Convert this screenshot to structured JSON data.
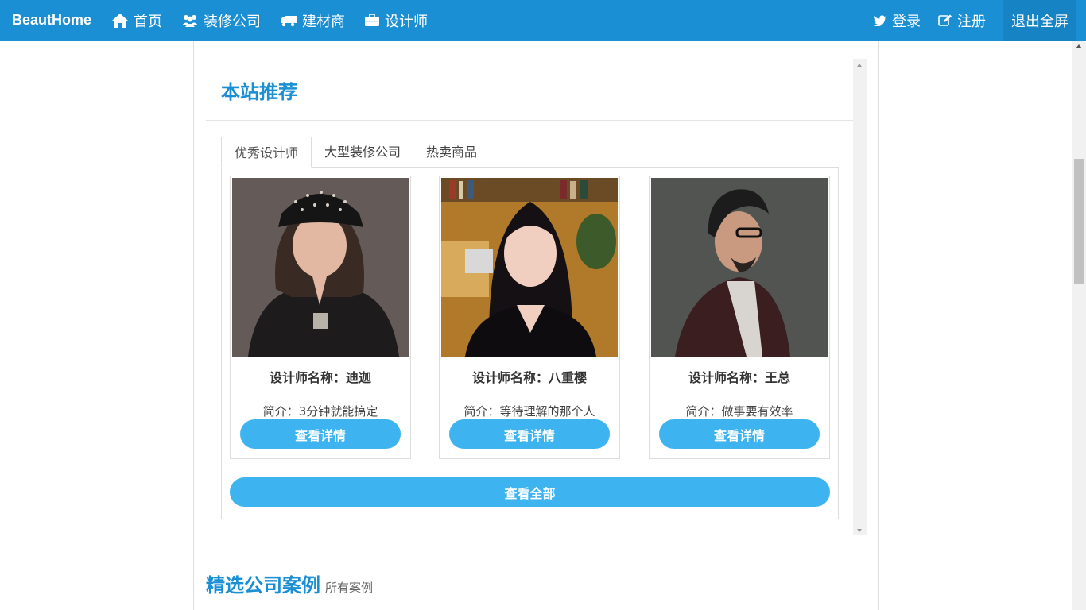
{
  "nav": {
    "brand": "BeautHome",
    "items": [
      {
        "label": "首页",
        "icon": "home-icon"
      },
      {
        "label": "装修公司",
        "icon": "users-icon"
      },
      {
        "label": "建材商",
        "icon": "truck-icon"
      },
      {
        "label": "设计师",
        "icon": "briefcase-icon"
      }
    ],
    "login": {
      "label": "登录",
      "icon": "twitter-icon"
    },
    "register": {
      "label": "注册",
      "icon": "edit-icon"
    },
    "fullscreen": "退出全屏"
  },
  "recommend": {
    "title": "本站推荐",
    "tabs": [
      "优秀设计师",
      "大型装修公司",
      "热卖商品"
    ],
    "active_tab": "优秀设计师",
    "designers": [
      {
        "name": "设计师名称：迪迦",
        "intro": "简介：3分钟就能搞定",
        "button": "查看详情"
      },
      {
        "name": "设计师名称：八重樱",
        "intro": "简介：等待理解的那个人",
        "button": "查看详情"
      },
      {
        "name": "设计师名称：王总",
        "intro": "简介：做事要有效率",
        "button": "查看详情"
      }
    ],
    "view_all": "查看全部"
  },
  "cases": {
    "title": "精选公司案例",
    "subtitle": "所有案例"
  },
  "colors": {
    "navbar": "#1b8fd3",
    "accent_button": "#3db4ef",
    "title_blue": "#1b8fd3"
  }
}
